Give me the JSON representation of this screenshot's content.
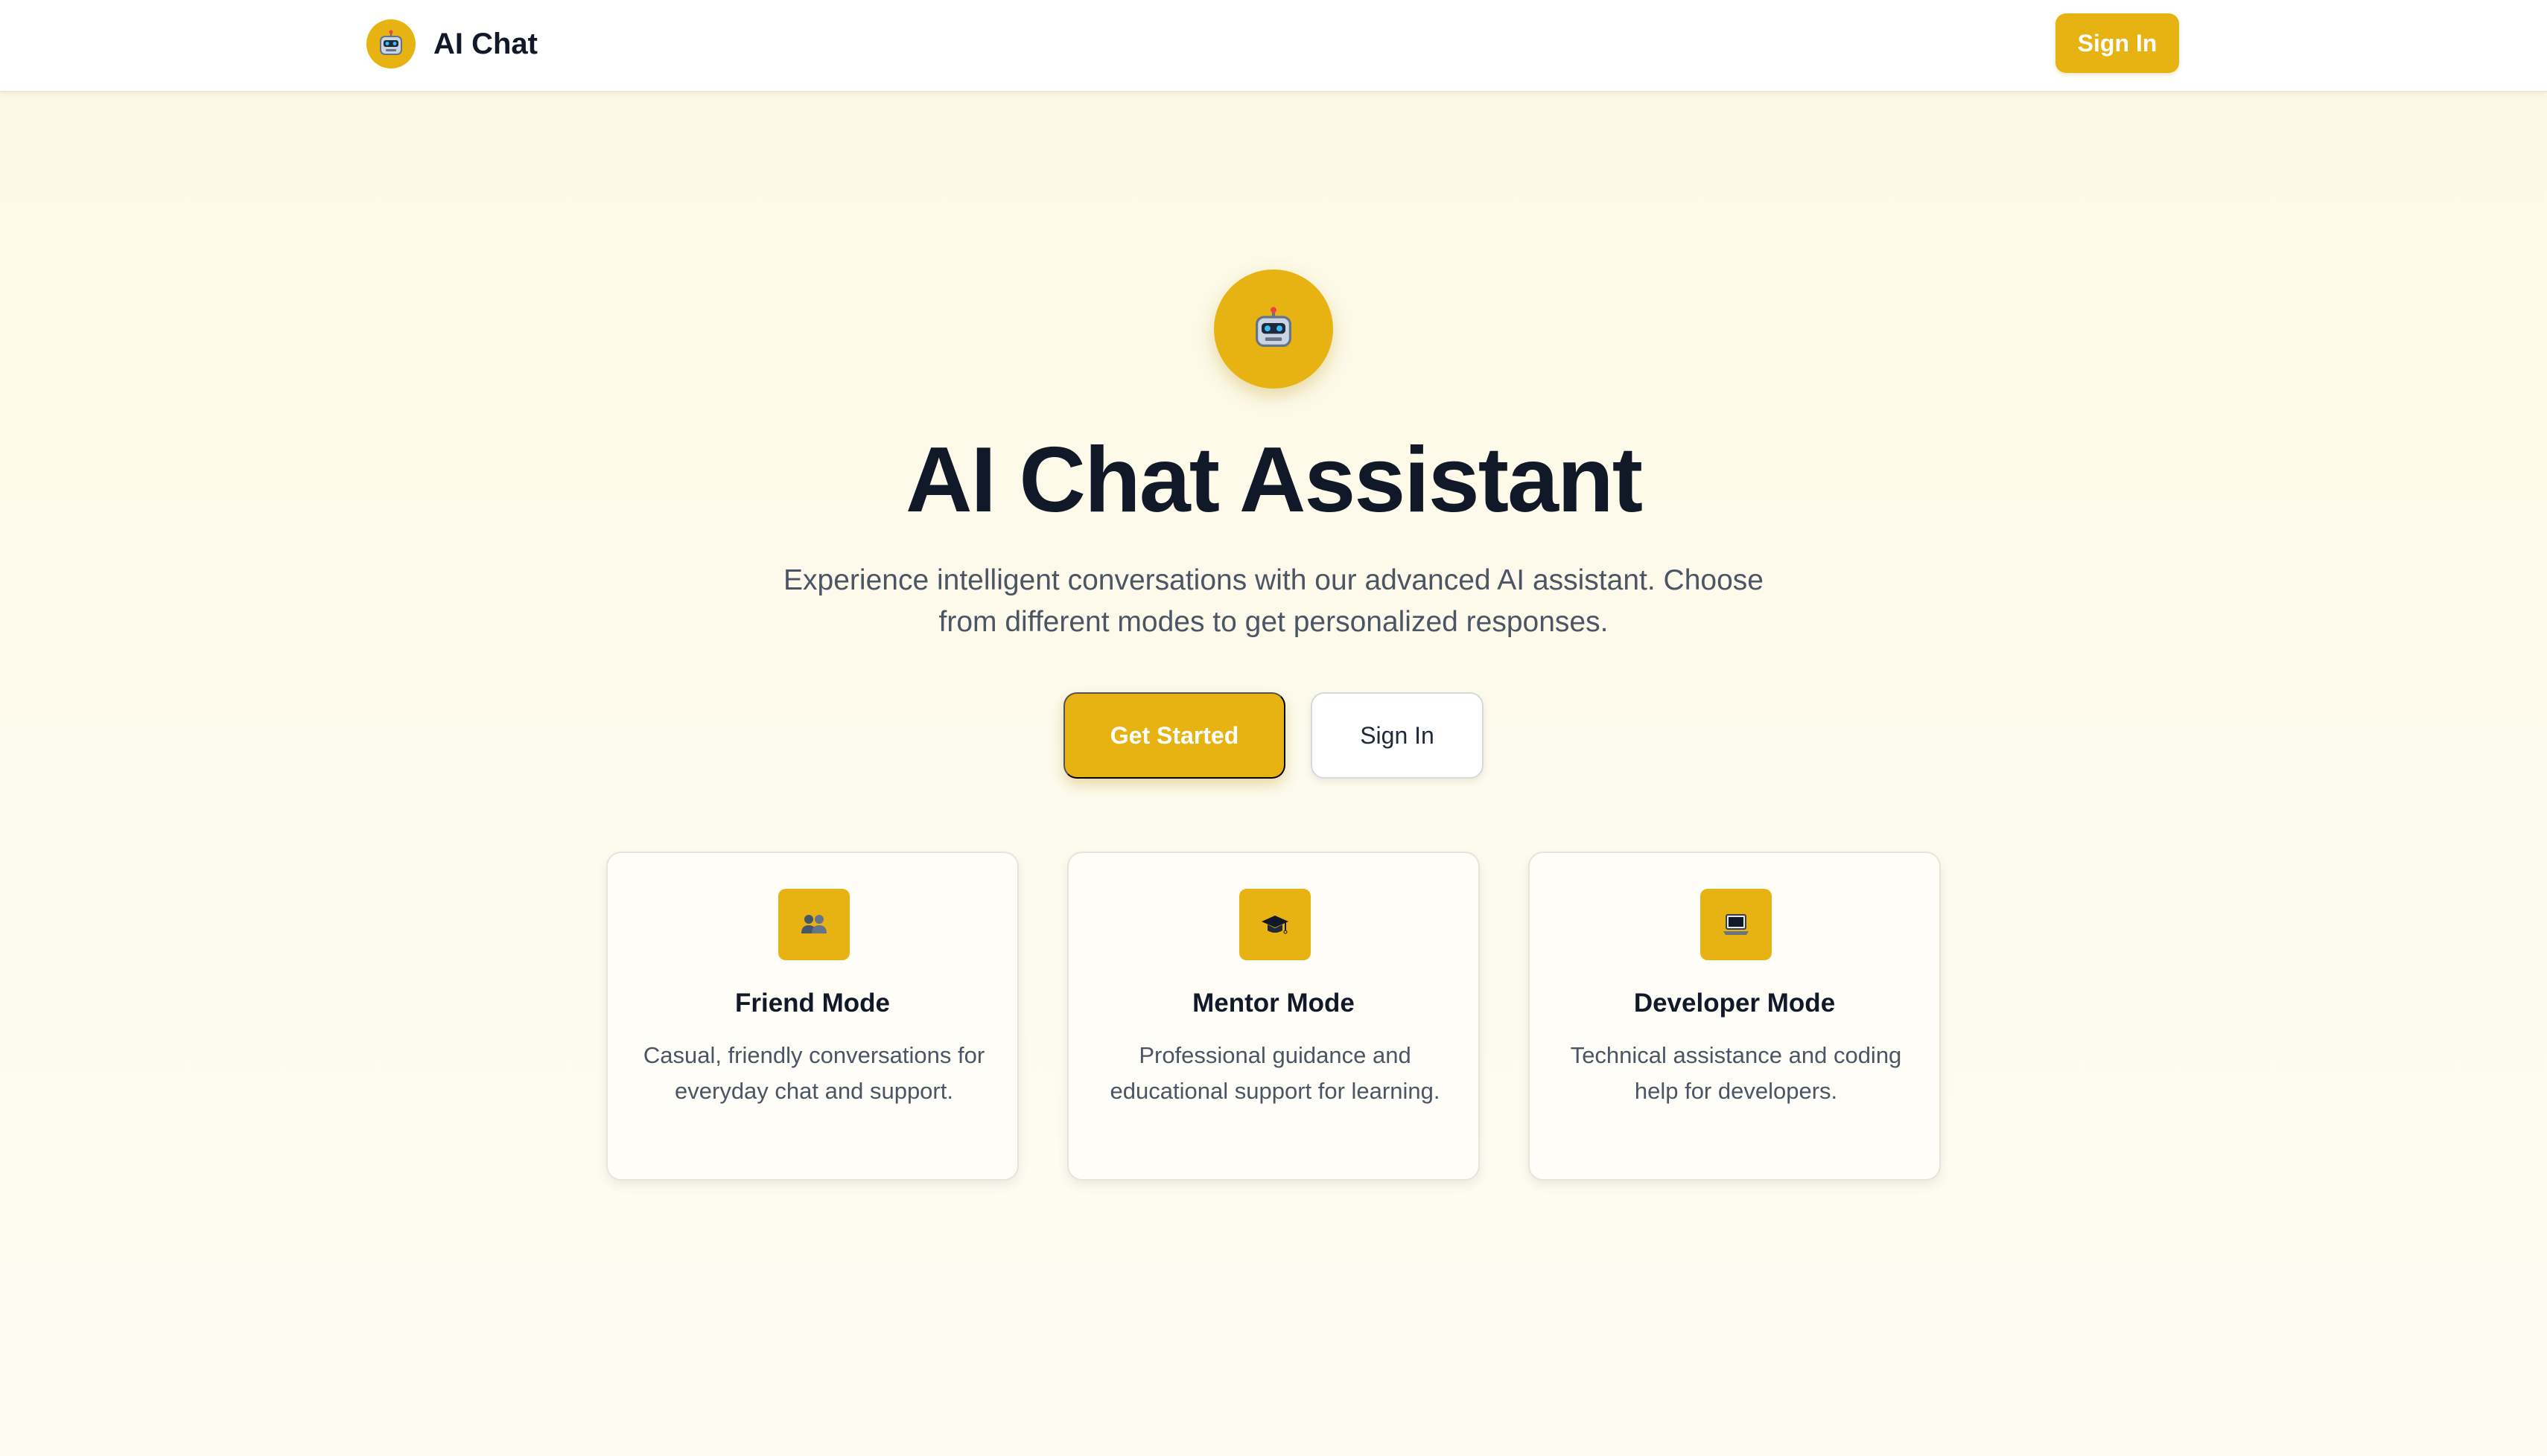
{
  "header": {
    "brand_name": "AI Chat",
    "brand_icon": "robot-icon",
    "signin_label": "Sign In"
  },
  "hero": {
    "icon": "robot-icon",
    "title": "AI Chat Assistant",
    "subtitle": "Experience intelligent conversations with our advanced AI assistant. Choose from different modes to get personalized responses.",
    "get_started_label": "Get Started",
    "signin_label": "Sign In"
  },
  "modes": [
    {
      "icon": "people-icon",
      "title": "Friend Mode",
      "description": "Casual, friendly conversations for everyday chat and support."
    },
    {
      "icon": "graduation-cap-icon",
      "title": "Mentor Mode",
      "description": "Professional guidance and educational support for learning."
    },
    {
      "icon": "laptop-icon",
      "title": "Developer Mode",
      "description": "Technical assistance and coding help for developers."
    }
  ],
  "colors": {
    "accent": "#e6b313",
    "background": "#fdfbec",
    "text_dark": "#111827",
    "text_muted": "#4b5563"
  }
}
